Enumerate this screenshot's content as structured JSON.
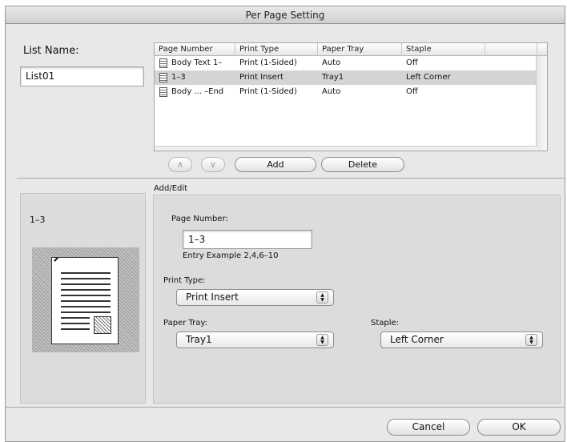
{
  "window": {
    "title": "Per Page Setting"
  },
  "list_name": {
    "label": "List Name:",
    "value": "List01"
  },
  "table": {
    "columns": [
      "Page Number",
      "Print Type",
      "Paper Tray",
      "Staple"
    ],
    "rows": [
      {
        "page": "Body Text 1–",
        "type": "Print (1-Sided)",
        "tray": "Auto",
        "staple": "Off",
        "selected": false
      },
      {
        "page": "1–3",
        "type": "Print Insert",
        "tray": "Tray1",
        "staple": "Left Corner",
        "selected": true
      },
      {
        "page": "Body ... –End",
        "type": "Print (1-Sided)",
        "tray": "Auto",
        "staple": "Off",
        "selected": false
      }
    ]
  },
  "row_buttons": {
    "up": "∧",
    "down": "∨",
    "add": "Add",
    "delete": "Delete"
  },
  "preview": {
    "label": "1–3"
  },
  "edit": {
    "group_label": "Add/Edit",
    "page_number_label": "Page Number:",
    "page_number_value": "1–3",
    "entry_example": "Entry Example 2,4,6–10",
    "print_type_label": "Print Type:",
    "print_type_value": "Print Insert",
    "paper_tray_label": "Paper Tray:",
    "paper_tray_value": "Tray1",
    "staple_label": "Staple:",
    "staple_value": "Left Corner"
  },
  "footer": {
    "cancel": "Cancel",
    "ok": "OK"
  },
  "icons": [
    "document-icon",
    "page-preview-icon",
    "stepper-arrows-icon"
  ]
}
